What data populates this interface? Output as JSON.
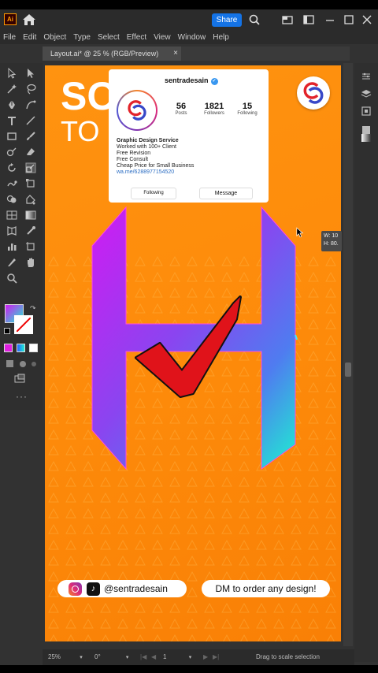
{
  "app": {
    "logo": "Ai",
    "share_label": "Share",
    "menu": [
      "File",
      "Edit",
      "Object",
      "Type",
      "Select",
      "Effect",
      "View",
      "Window",
      "Help"
    ],
    "document_tab": "Layout.ai* @ 25 % (RGB/Preview)",
    "tab_close": "×"
  },
  "canvas": {
    "headline_1": "SO",
    "headline_2": "TO",
    "instagram": {
      "username": "sentradesain",
      "posts_count": "56",
      "posts_label": "Posts",
      "followers_count": "1821",
      "followers_label": "Followers",
      "following_count": "15",
      "following_label": "Following",
      "bio_title": "Graphic Design Service",
      "bio_lines": [
        "Worked with 100+ Client",
        "Free Revision",
        "Free Consult",
        "Cheap Price for Small Business"
      ],
      "bio_link": "wa.me/6288977154520",
      "following_button": "Following",
      "message_button": "Message"
    },
    "handle": "@sentradesain",
    "cta": "DM to order any design!"
  },
  "transform": {
    "width": "W: 10",
    "height": "H: 80."
  },
  "statusbar": {
    "zoom": "25%",
    "rotation": "0°",
    "artboard": "1",
    "hint": "Drag to scale selection"
  },
  "colors": {
    "accent": "#1473e6",
    "canvas_orange": "#fd8a0a",
    "h_gradient_top": "#d01bf2",
    "h_gradient_bottom": "#1ef0d0",
    "check_red": "#e0131a"
  }
}
